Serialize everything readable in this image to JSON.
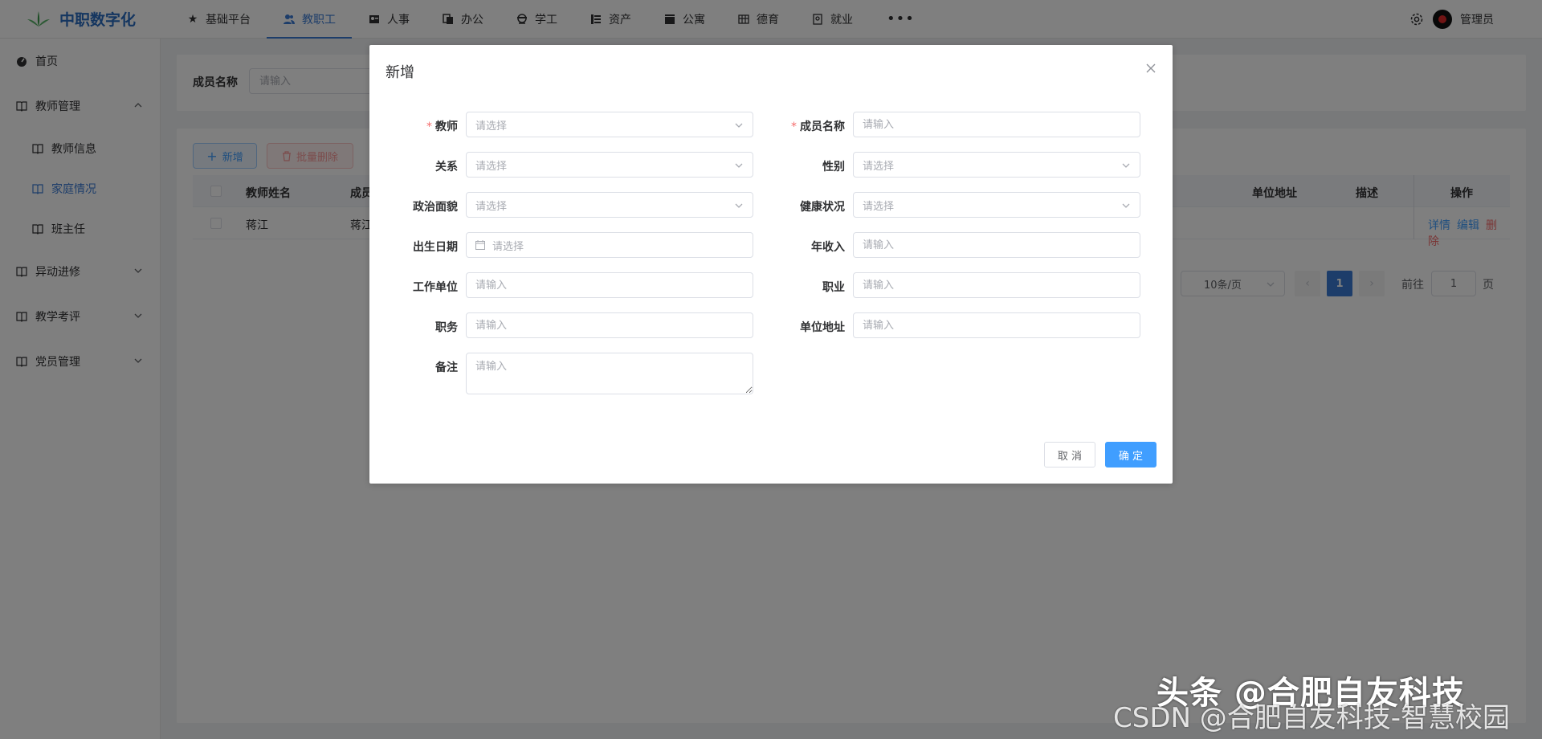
{
  "app": {
    "title": "中职数字化"
  },
  "nav": {
    "items": [
      {
        "label": "基础平台",
        "icon": "star-icon"
      },
      {
        "label": "教职工",
        "icon": "people-icon",
        "active": true
      },
      {
        "label": "人事",
        "icon": "id-card-icon"
      },
      {
        "label": "办公",
        "icon": "copy-icon"
      },
      {
        "label": "学工",
        "icon": "student-icon"
      },
      {
        "label": "资产",
        "icon": "list-icon"
      },
      {
        "label": "公寓",
        "icon": "clapper-icon"
      },
      {
        "label": "德育",
        "icon": "grid-icon"
      },
      {
        "label": "就业",
        "icon": "badge-icon"
      }
    ],
    "more": "•••"
  },
  "user": {
    "name": "管理员"
  },
  "sidebar": {
    "home": "首页",
    "teacher_mgmt": "教师管理",
    "sub": [
      "教师信息",
      "家庭情况",
      "班主任"
    ],
    "transfer": "异动进修",
    "evaluation": "教学考评",
    "party": "党员管理"
  },
  "search": {
    "label": "成员名称",
    "placeholder": "请输入"
  },
  "toolbar": {
    "add": "新增",
    "batch_delete": "批量删除"
  },
  "table": {
    "headers": {
      "teacher_name": "教师姓名",
      "member_name": "成员",
      "unit_address": "单位地址",
      "description": "描述",
      "ops": "操作"
    },
    "rows": [
      {
        "teacher_name": "蒋江",
        "member_name": "蒋江"
      }
    ],
    "actions": {
      "detail": "详情",
      "edit": "编辑",
      "delete": "删除"
    }
  },
  "pagination": {
    "page_size": "10条/页",
    "current_page": "1",
    "goto_label": "前往",
    "goto_value": "1",
    "goto_suffix": "页"
  },
  "dialog": {
    "title": "新增",
    "fields": {
      "teacher": {
        "label": "教师",
        "placeholder": "请选择"
      },
      "member_name": {
        "label": "成员名称",
        "placeholder": "请输入"
      },
      "relation": {
        "label": "关系",
        "placeholder": "请选择"
      },
      "gender": {
        "label": "性别",
        "placeholder": "请选择"
      },
      "politics": {
        "label": "政治面貌",
        "placeholder": "请选择"
      },
      "health": {
        "label": "健康状况",
        "placeholder": "请选择"
      },
      "birth_date": {
        "label": "出生日期",
        "placeholder": "请选择"
      },
      "income": {
        "label": "年收入",
        "placeholder": "请输入"
      },
      "work_unit": {
        "label": "工作单位",
        "placeholder": "请输入"
      },
      "occupation": {
        "label": "职业",
        "placeholder": "请输入"
      },
      "position": {
        "label": "职务",
        "placeholder": "请输入"
      },
      "unit_address": {
        "label": "单位地址",
        "placeholder": "请输入"
      },
      "remark": {
        "label": "备注",
        "placeholder": "请输入"
      }
    },
    "required_mark": "*",
    "cancel": "取 消",
    "confirm": "确 定"
  },
  "watermark": {
    "line1": "头条 @合肥自友科技",
    "line2": "CSDN @合肥自友科技-智慧校园"
  },
  "colors": {
    "primary": "#409eff",
    "brand": "#2a6cc0",
    "danger": "#f56c6c"
  }
}
